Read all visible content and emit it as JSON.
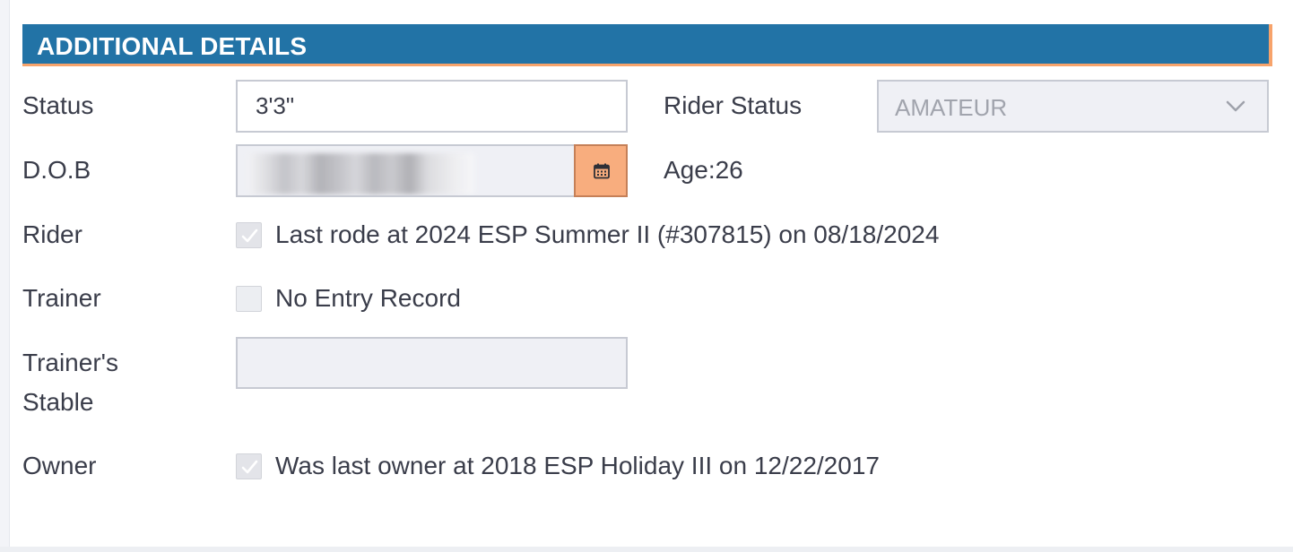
{
  "section": {
    "title": "ADDITIONAL DETAILS"
  },
  "fields": {
    "status": {
      "label": "Status",
      "value": "3'3\""
    },
    "rider_status": {
      "label": "Rider Status",
      "selected": "AMATEUR"
    },
    "dob": {
      "label": "D.O.B",
      "value": ""
    },
    "age": {
      "label": "Age:",
      "value": "26"
    },
    "rider": {
      "label": "Rider",
      "checked": true,
      "text": "Last rode at 2024 ESP Summer II (#307815) on 08/18/2024"
    },
    "trainer": {
      "label": "Trainer",
      "checked": false,
      "text": "No Entry Record"
    },
    "trainers_stable": {
      "label_line1": "Trainer's",
      "label_line2": "Stable",
      "value": ""
    },
    "owner": {
      "label": "Owner",
      "checked": true,
      "text": "Was last owner at 2018 ESP Holiday III on 12/22/2017"
    }
  },
  "icons": {
    "calendar": "calendar-icon",
    "chevron": "chevron-down-icon",
    "check": "checkmark-icon"
  },
  "colors": {
    "header_bg": "#2273a6",
    "header_accent": "#f7a36b",
    "calendar_button": "#f8ad7e"
  }
}
